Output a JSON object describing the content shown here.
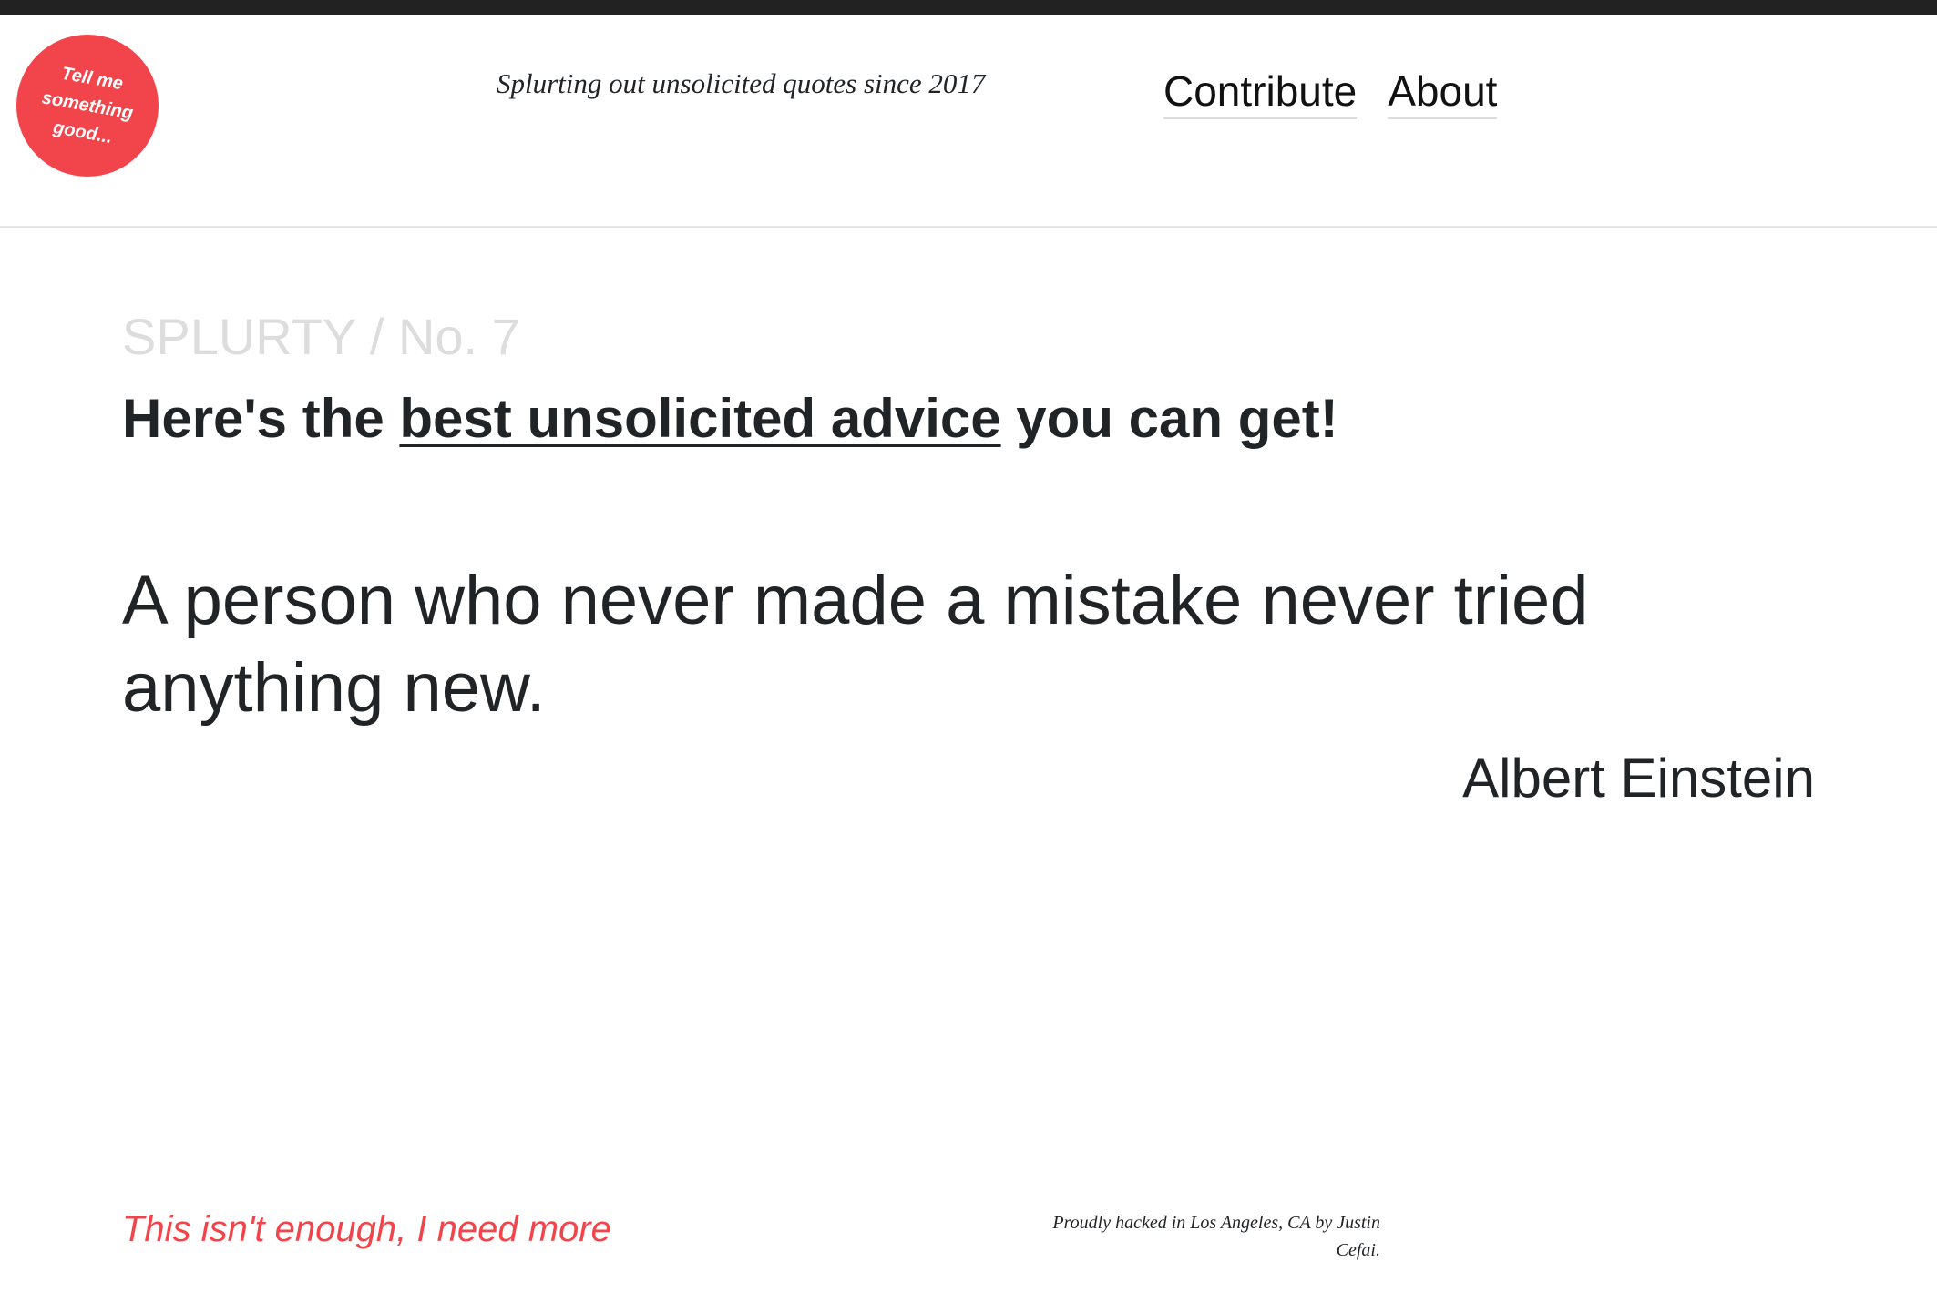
{
  "header": {
    "logo_lines": [
      "Tell me",
      "something",
      "good..."
    ],
    "tagline": "Splurting out unsolicited quotes since 2017",
    "nav": {
      "contribute": "Contribute",
      "about": "About"
    }
  },
  "main": {
    "kicker": "SPLURTY / No. 7",
    "headline_prefix": "Here's the ",
    "headline_link": "best unsolicited advice",
    "headline_suffix": " you can get!",
    "quote": "A person who never made a mistake never tried anything new.",
    "author": "Albert Einstein"
  },
  "footer": {
    "more_link": "This isn't enough, I need more",
    "credit": "Proudly hacked in Los Angeles, CA by Justin Cefai."
  },
  "colors": {
    "accent": "#f2444b",
    "text": "#212427",
    "muted": "#dddddd",
    "topbar": "#222222"
  }
}
